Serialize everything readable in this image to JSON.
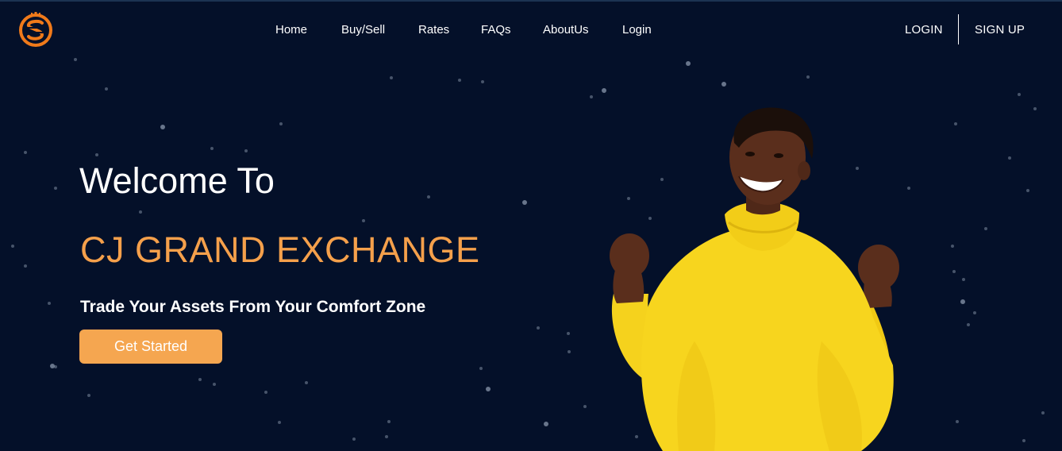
{
  "brand": {
    "logo_icon": "s-coin-logo-icon",
    "accent_color": "#f5a04b",
    "background_color": "#041029"
  },
  "nav": {
    "items": [
      {
        "label": "Home"
      },
      {
        "label": "Buy/Sell"
      },
      {
        "label": "Rates"
      },
      {
        "label": "FAQs"
      },
      {
        "label": "AboutUs"
      },
      {
        "label": "Login"
      }
    ]
  },
  "auth": {
    "login_label": "LOGIN",
    "signup_label": "SIGN UP"
  },
  "hero": {
    "welcome": "Welcome To",
    "brand_name": "CJ GRAND EXCHANGE",
    "tagline": "Trade Your Assets From Your Comfort Zone",
    "cta_label": "Get Started",
    "image": "smiling-woman-yellow-sweater-celebrating"
  }
}
